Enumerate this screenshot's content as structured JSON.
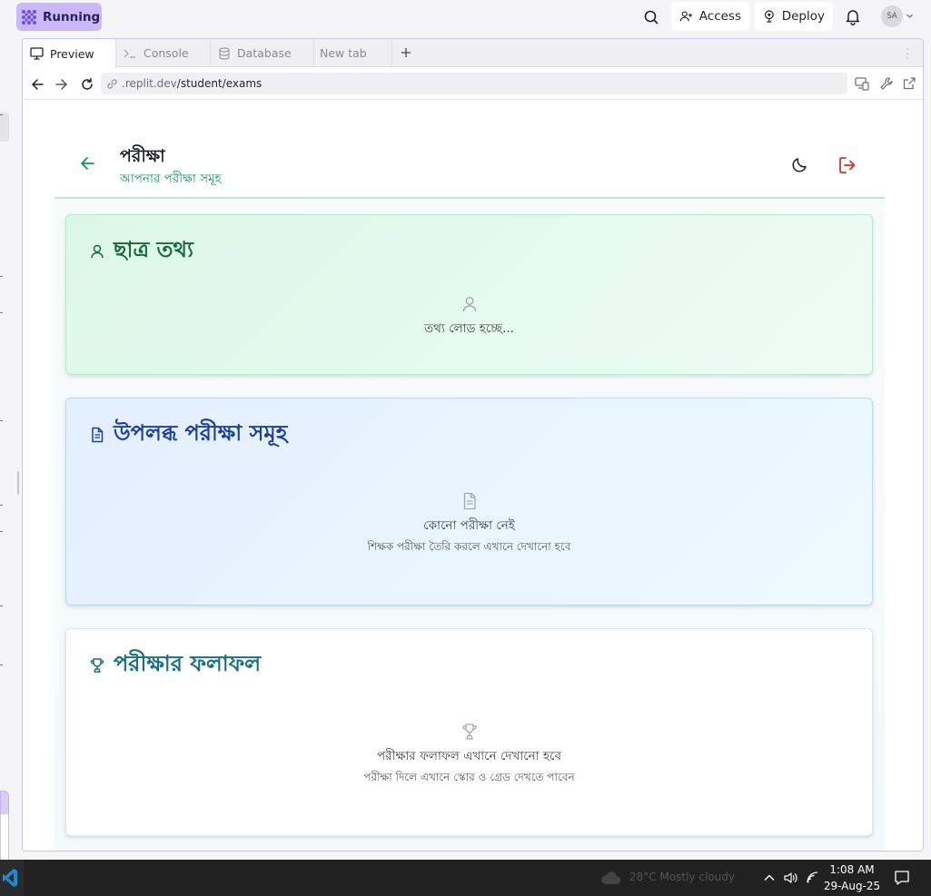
{
  "topbar": {
    "run_status": "Running",
    "access_label": "Access",
    "deploy_label": "Deploy",
    "avatar_initials": "SA"
  },
  "tabs": [
    {
      "label": "Preview",
      "icon": "monitor-icon",
      "active": true
    },
    {
      "label": "Console",
      "icon": "terminal-icon",
      "active": false
    },
    {
      "label": "Database",
      "icon": "database-icon",
      "active": false
    },
    {
      "label": "New tab",
      "icon": "",
      "active": false
    }
  ],
  "browser": {
    "url_host": ".replit.dev",
    "url_path": "/student/exams"
  },
  "app": {
    "title": "পরীক্ষা",
    "subtitle": "আপনার পরীক্ষা সমূহ",
    "colors": {
      "accent_green": "#13955f",
      "logout_red": "#d1342f",
      "student_heading": "#176a3b",
      "exams_heading": "#1d3fa0",
      "results_heading": "#1a6f83"
    },
    "student_card": {
      "heading": "ছাত্র তথ্য",
      "icon": "user-icon",
      "loading_text": "তথ্য লোড হচ্ছে..."
    },
    "exams_card": {
      "heading": "উপলব্ধ পরীক্ষা সমূহ",
      "icon": "document-icon",
      "empty_title": "কোনো পরীক্ষা নেই",
      "empty_subtitle": "শিক্ষক পরীক্ষা তৈরি করলে এখানে দেখানো হবে"
    },
    "results_card": {
      "heading": "পরীক্ষার ফলাফল",
      "icon": "trophy-icon",
      "empty_title": "পরীক্ষার ফলাফল এখানে দেখানো হবে",
      "empty_subtitle": "পরীক্ষা দিলে এখানে স্কোর ও গ্রেড দেখতে পাবেন"
    }
  },
  "taskbar": {
    "weather": "28°C  Mostly cloudy",
    "time": "1:08 AM",
    "date": "29-Aug-25"
  }
}
